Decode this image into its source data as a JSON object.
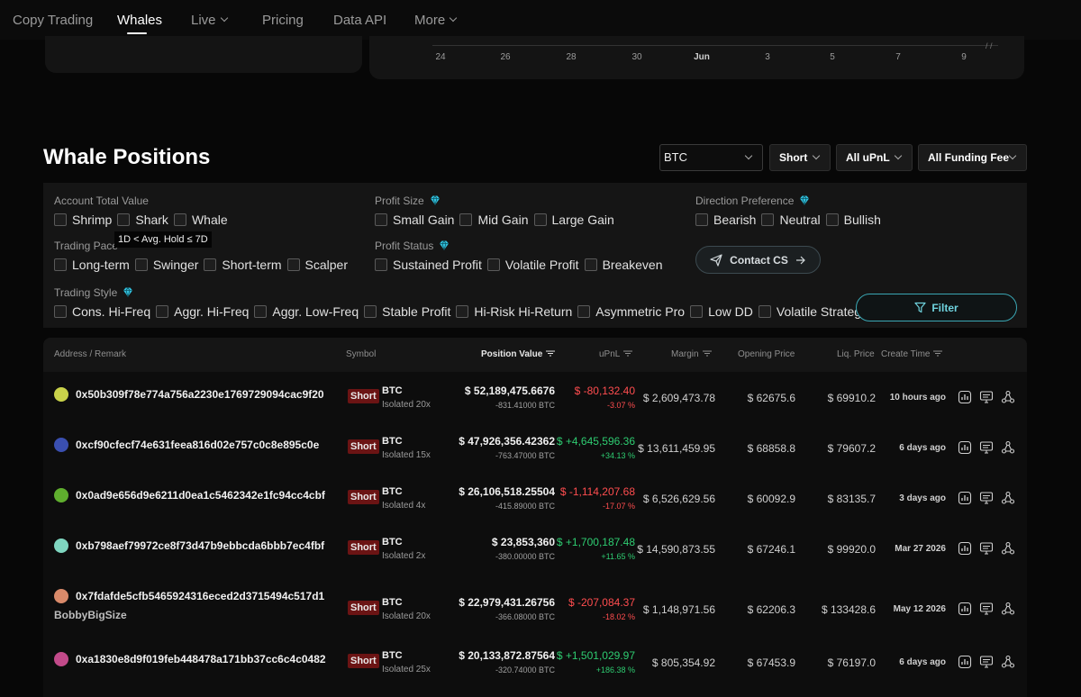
{
  "nav": {
    "items": [
      {
        "label": "Copy Trading",
        "dropdown": false
      },
      {
        "label": "Whales",
        "dropdown": false,
        "active": true
      },
      {
        "label": "Live",
        "dropdown": true
      },
      {
        "label": "Pricing",
        "dropdown": false
      },
      {
        "label": "Data API",
        "dropdown": false
      },
      {
        "label": "More",
        "dropdown": true
      }
    ]
  },
  "chart": {
    "x_ticks": [
      "24",
      "26",
      "28",
      "30",
      "Jun",
      "3",
      "5",
      "7",
      "9"
    ]
  },
  "header": {
    "title": "Whale Positions",
    "symbol_select": "BTC",
    "direction_select": "Short",
    "upnl_select": "All uPnL",
    "funding_select": "All Funding Fee"
  },
  "filters": {
    "account_total_value": {
      "title": "Account Total Value",
      "options": [
        "Shrimp",
        "Shark",
        "Whale"
      ]
    },
    "trading_pace": {
      "title": "Trading Pace",
      "options": [
        "Long-term",
        "Swinger",
        "Short-term",
        "Scalper"
      ]
    },
    "trading_style": {
      "title": "Trading Style",
      "options": [
        "Cons. Hi-Freq",
        "Aggr. Hi-Freq",
        "Aggr. Low-Freq",
        "Stable Profit",
        "Hi-Risk Hi-Return",
        "Asymmetric Pro",
        "Low DD",
        "Volatile Strategy"
      ]
    },
    "profit_size": {
      "title": "Profit Size",
      "options": [
        "Small Gain",
        "Mid Gain",
        "Large Gain"
      ]
    },
    "profit_status": {
      "title": "Profit Status",
      "options": [
        "Sustained Profit",
        "Volatile Profit",
        "Breakeven"
      ]
    },
    "direction_preference": {
      "title": "Direction Preference",
      "options": [
        "Bearish",
        "Neutral",
        "Bullish"
      ]
    },
    "tooltip": "1D < Avg. Hold ≤ 7D",
    "contact_label": "Contact CS",
    "filter_label": "Filter"
  },
  "table": {
    "columns": [
      "Address / Remark",
      "Symbol",
      "Position Value",
      "uPnL",
      "Margin",
      "Opening Price",
      "Liq. Price",
      "Create Time"
    ],
    "rows": [
      {
        "address": "0x50b309f78e774a756a2230e1769729094cac9f20",
        "remark": "",
        "side": "Short",
        "symbol": "BTC",
        "leverage": "Isolated 20x",
        "position_value": "$ 52,189,475.6676",
        "position_qty": "-831.41000 BTC",
        "upnl": "$ -80,132.40",
        "upnl_pct": "-3.07 %",
        "upnl_positive": false,
        "margin": "$ 2,609,473.78",
        "opening_price": "$ 62675.6",
        "liq_price": "$ 69910.2",
        "create_time": "10 hours ago",
        "avatar_color": "#c9d24a"
      },
      {
        "address": "0xcf90cfecf74e631feea816d02e757c0c8e895c0e",
        "remark": "",
        "side": "Short",
        "symbol": "BTC",
        "leverage": "Isolated 15x",
        "position_value": "$ 47,926,356.42362",
        "position_qty": "-763.47000 BTC",
        "upnl": "$ +4,645,596.36",
        "upnl_pct": "+34.13 %",
        "upnl_positive": true,
        "margin": "$ 13,611,459.95",
        "opening_price": "$ 68858.8",
        "liq_price": "$ 79607.2",
        "create_time": "6 days ago",
        "avatar_color": "#3a4fb0"
      },
      {
        "address": "0x0ad9e656d9e6211d0ea1c5462342e1fc94cc4cbf",
        "remark": "",
        "side": "Short",
        "symbol": "BTC",
        "leverage": "Isolated 4x",
        "position_value": "$ 26,106,518.25504",
        "position_qty": "-415.89000 BTC",
        "upnl": "$ -1,114,207.68",
        "upnl_pct": "-17.07 %",
        "upnl_positive": false,
        "margin": "$ 6,526,629.56",
        "opening_price": "$ 60092.9",
        "liq_price": "$ 83135.7",
        "create_time": "3 days ago",
        "avatar_color": "#5fae2e"
      },
      {
        "address": "0xb798aef79972ce8f73d47b9ebbcda6bbb7ec4fbf",
        "remark": "",
        "side": "Short",
        "symbol": "BTC",
        "leverage": "Isolated 2x",
        "position_value": "$ 23,853,360",
        "position_qty": "-380.00000 BTC",
        "upnl": "$ +1,700,187.48",
        "upnl_pct": "+11.65 %",
        "upnl_positive": true,
        "margin": "$ 14,590,873.55",
        "opening_price": "$ 67246.1",
        "liq_price": "$ 99920.0",
        "create_time": "Mar 27 2026",
        "avatar_color": "#7fd6c0"
      },
      {
        "address": "0x7fdafde5cfb5465924316eced2d3715494c517d1",
        "remark": "BobbyBigSize",
        "side": "Short",
        "symbol": "BTC",
        "leverage": "Isolated 20x",
        "position_value": "$ 22,979,431.26756",
        "position_qty": "-366.08000 BTC",
        "upnl": "$ -207,084.37",
        "upnl_pct": "-18.02 %",
        "upnl_positive": false,
        "margin": "$ 1,148,971.56",
        "opening_price": "$ 62206.3",
        "liq_price": "$ 133428.6",
        "create_time": "May 12 2026",
        "avatar_color": "#d98a6a"
      },
      {
        "address": "0xa1830e8d9f019feb448478a171bb37cc6c4c0482",
        "remark": "",
        "side": "Short",
        "symbol": "BTC",
        "leverage": "Isolated 25x",
        "position_value": "$ 20,133,872.87564",
        "position_qty": "-320.74000 BTC",
        "upnl": "$ +1,501,029.97",
        "upnl_pct": "+186.38 %",
        "upnl_positive": true,
        "margin": "$ 805,354.92",
        "opening_price": "$ 67453.9",
        "liq_price": "$ 76197.0",
        "create_time": "6 days ago",
        "avatar_color": "#c24a8a"
      }
    ]
  },
  "colors": {
    "accent": "#3aa6b3",
    "short_badge": "#6b1414",
    "negative": "#ff4d4f",
    "positive": "#2ecc71",
    "gem": "#33c3e0"
  },
  "icons": {
    "gem": "diamond-icon",
    "send": "send-icon",
    "arrow": "arrow-right-icon",
    "filter": "filter-icon",
    "row_actions": [
      "chart-icon",
      "monitor-icon",
      "share-icon"
    ]
  }
}
